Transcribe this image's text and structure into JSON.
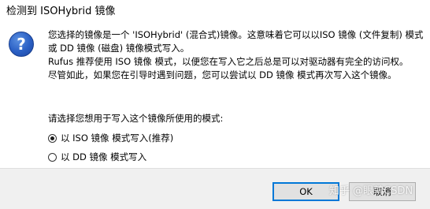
{
  "window": {
    "title": "检测到 ISOHybrid 镜像"
  },
  "icon": "question-icon",
  "message": {
    "paragraph1": "您选择的镜像是一个 'ISOHybrid' (混合式)镜像。这意味着它可以以ISO 镜像 (文件复制) 模式或 DD 镜像 (磁盘) 镜像模式写入。",
    "paragraph2": "Rufus 推荐使用 ISO 镜像 模式，以便您在写入它之后总是可以对驱动器有完全的访问权。",
    "paragraph3": "尽管如此，如果您在引导时遇到问题，您可以尝试以 DD 镜像 模式再次写入这个镜像。",
    "prompt": "请选择您想用于写入这个镜像所使用的模式:"
  },
  "options": [
    {
      "label": "以 ISO 镜像 模式写入(推荐)",
      "checked": true
    },
    {
      "label": "以 DD 镜像 模式写入",
      "checked": false
    }
  ],
  "buttons": {
    "ok": "OK",
    "cancel": "取消"
  },
  "watermark": "知乎 @眼鹑CSDN",
  "colors": {
    "focus_border": "#0078d7",
    "icon_blue": "#2a5fc4",
    "button_bar": "#f0f0f0"
  }
}
